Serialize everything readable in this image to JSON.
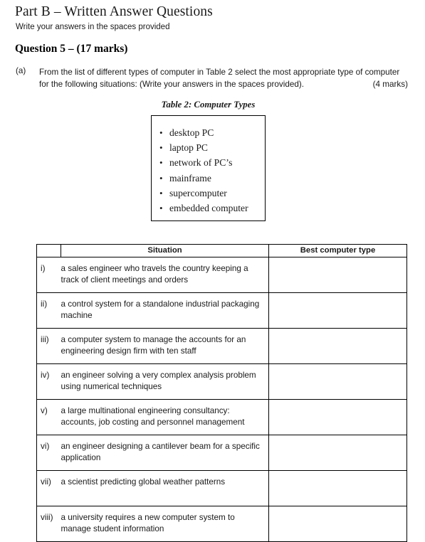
{
  "header": {
    "part_title": "Part B – Written Answer Questions",
    "part_subtitle": "Write your answers in the spaces provided",
    "question_heading": "Question 5 – (17 marks)"
  },
  "part_a": {
    "label": "(a)",
    "line1": "From the list of different types of computer in Table 2 select the most appropriate type of computer",
    "line2": "for the following situations:  (Write your answers in the spaces provided).",
    "marks": "(4 marks)"
  },
  "table2": {
    "caption": "Table 2: Computer Types",
    "bullet_glyph": "•",
    "items": [
      "desktop PC",
      "laptop PC",
      "network of PC’s",
      "mainframe",
      "supercomputer",
      "embedded computer"
    ]
  },
  "situations_table": {
    "headers": {
      "number": "",
      "situation": "Situation",
      "answer": "Best computer type"
    },
    "rows": [
      {
        "number": "i)",
        "line1": "a sales engineer who travels the country keeping a",
        "line2": "track of client meetings and orders",
        "answer": ""
      },
      {
        "number": "ii)",
        "line1": "a control system for a standalone industrial packaging",
        "line2": "machine",
        "answer": ""
      },
      {
        "number": "iii)",
        "line1": "a computer system to manage the accounts for an",
        "line2": "engineering design firm with ten staff",
        "answer": ""
      },
      {
        "number": "iv)",
        "line1": "an engineer solving a very complex analysis problem",
        "line2": "using numerical techniques",
        "answer": ""
      },
      {
        "number": "v)",
        "line1": "a large multinational engineering consultancy:",
        "line2": "accounts, job costing and personnel management",
        "answer": ""
      },
      {
        "number": "vi)",
        "line1": "an engineer designing a cantilever beam for a specific",
        "line2": "application",
        "answer": ""
      },
      {
        "number": "vii)",
        "line1": "a scientist predicting global weather patterns",
        "line2": "",
        "answer": ""
      },
      {
        "number": "viii)",
        "line1": "a university requires a new computer system to",
        "line2": "manage student  information",
        "answer": ""
      }
    ]
  }
}
